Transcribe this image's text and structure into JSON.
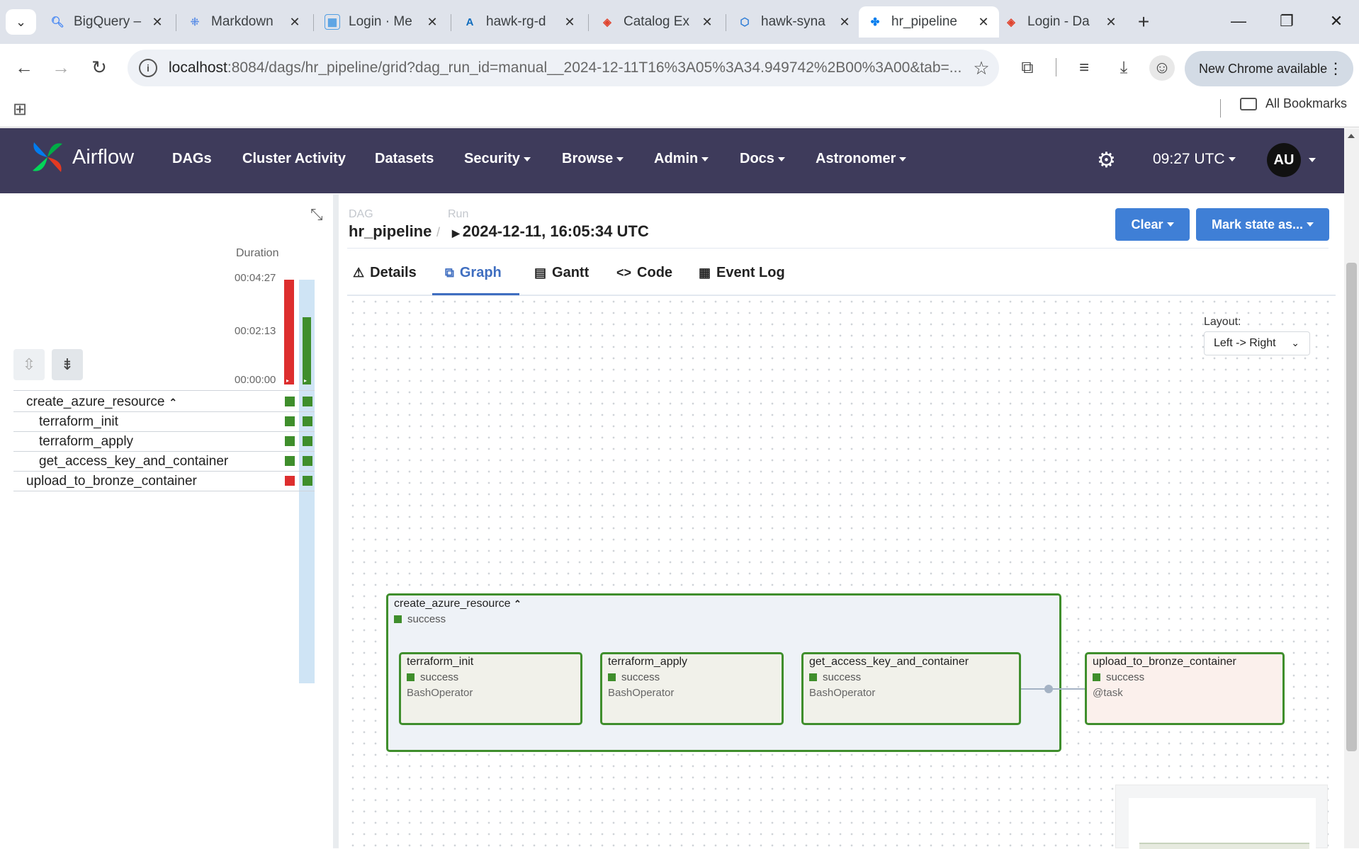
{
  "browser": {
    "tabs": [
      {
        "title": "BigQuery –",
        "active": false,
        "icon": "bigquery-icon",
        "color": "#4285f4"
      },
      {
        "title": "Markdown",
        "active": false,
        "icon": "markdown-icon",
        "color": "#5b8ee6"
      },
      {
        "title": "Login · Me",
        "active": false,
        "icon": "metabase-icon",
        "color": "#509ee3"
      },
      {
        "title": "hawk-rg-d",
        "active": false,
        "icon": "azure-icon",
        "color": "#0f6cbd"
      },
      {
        "title": "Catalog Ex",
        "active": false,
        "icon": "databricks-icon",
        "color": "#e0442e"
      },
      {
        "title": "hawk-syna",
        "active": false,
        "icon": "synapse-icon",
        "color": "#2b7bd6"
      },
      {
        "title": "hr_pipeline",
        "active": true,
        "icon": "airflow-icon",
        "color": "#017cee"
      },
      {
        "title": "Login - Da",
        "active": false,
        "icon": "databricks-icon",
        "color": "#e0442e"
      }
    ],
    "url_host": "localhost",
    "url_rest": ":8084/dags/hr_pipeline/grid?dag_run_id=manual__2024-12-11T16%3A05%3A34.949742%2B00%3A00&tab=...",
    "new_chrome": "New Chrome available",
    "all_bookmarks": "All Bookmarks"
  },
  "airflow_nav": {
    "brand": "Airflow",
    "items": [
      "DAGs",
      "Cluster Activity",
      "Datasets",
      "Security",
      "Browse",
      "Admin",
      "Docs",
      "Astronomer"
    ],
    "time": "09:27 UTC",
    "user_initials": "AU"
  },
  "grid": {
    "duration_label": "Duration",
    "ticks": [
      "00:04:27",
      "00:02:13",
      "00:00:00"
    ],
    "runs": [
      {
        "duration_seconds": 267,
        "state": "failed",
        "color": "#dd2e2e"
      },
      {
        "duration_seconds": 172,
        "state": "success",
        "color": "#3f8e2c"
      }
    ],
    "tasks": [
      {
        "name": "create_azure_resource",
        "indent": 0,
        "group": true,
        "states": [
          "success",
          "success"
        ]
      },
      {
        "name": "terraform_init",
        "indent": 1,
        "group": false,
        "states": [
          "success",
          "success"
        ]
      },
      {
        "name": "terraform_apply",
        "indent": 1,
        "group": false,
        "states": [
          "success",
          "success"
        ]
      },
      {
        "name": "get_access_key_and_container",
        "indent": 1,
        "group": false,
        "states": [
          "success",
          "success"
        ]
      },
      {
        "name": "upload_to_bronze_container",
        "indent": 0,
        "group": false,
        "states": [
          "failed",
          "success"
        ]
      }
    ]
  },
  "header": {
    "dag_label": "DAG",
    "dag_name": "hr_pipeline",
    "run_label": "Run",
    "run_name": "2024-12-11, 16:05:34 UTC",
    "clear": "Clear",
    "mark_state": "Mark state as..."
  },
  "tabs": [
    "Details",
    "Graph",
    "Gantt",
    "Code",
    "Event Log"
  ],
  "active_tab": "Graph",
  "graph": {
    "layout_label": "Layout:",
    "layout_value": "Left -> Right",
    "group": {
      "name": "create_azure_resource",
      "state": "success"
    },
    "nodes": [
      {
        "name": "terraform_init",
        "state": "success",
        "operator": "BashOperator"
      },
      {
        "name": "terraform_apply",
        "state": "success",
        "operator": "BashOperator"
      },
      {
        "name": "get_access_key_and_container",
        "state": "success",
        "operator": "BashOperator"
      },
      {
        "name": "upload_to_bronze_container",
        "state": "success",
        "operator": "@task"
      }
    ]
  },
  "colors": {
    "success": "#3f8e2c",
    "failed": "#dd2e2e",
    "nav_bg": "#3e3b5b",
    "accent": "#3f7fd6"
  }
}
